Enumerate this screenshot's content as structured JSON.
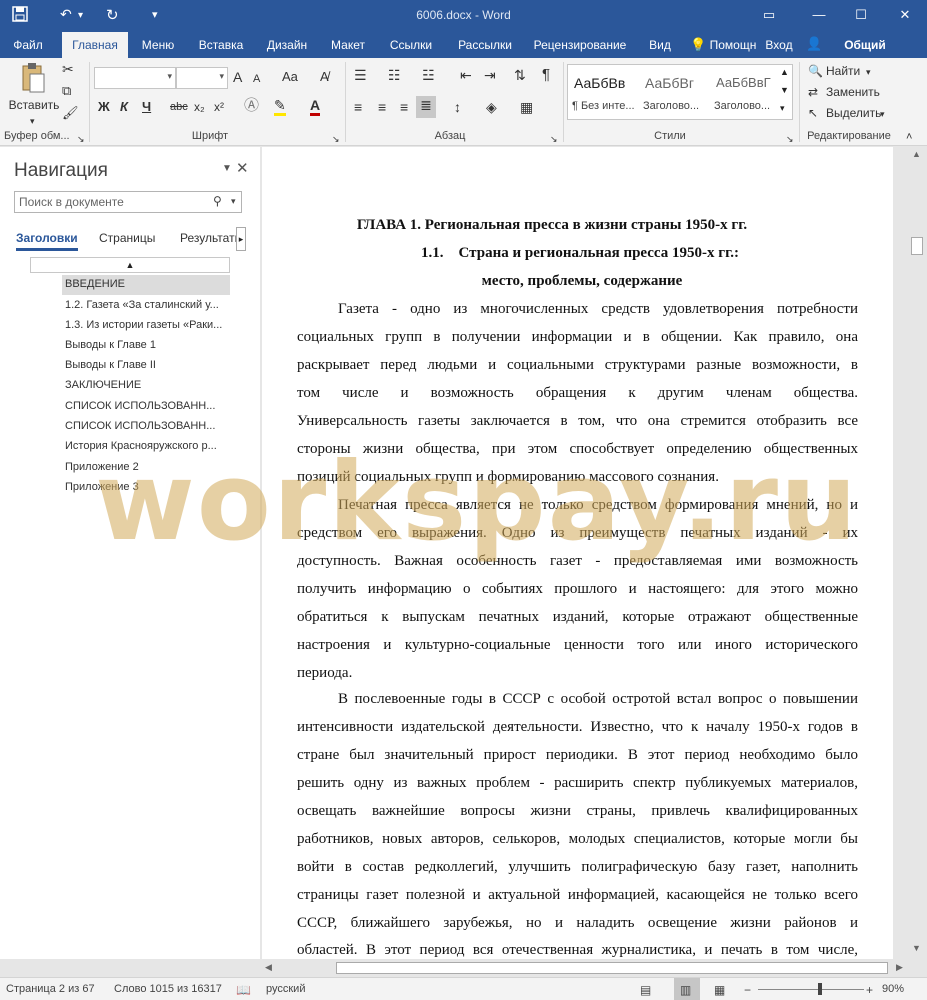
{
  "titlebar": {
    "doc_title": "6006.docx - Word",
    "window_controls": [
      "ribbon-display-icon",
      "minimize-icon",
      "maximize-icon",
      "close-icon"
    ]
  },
  "tabs": {
    "file": "Файл",
    "home": "Главная",
    "menu": "Меню",
    "insert": "Вставка",
    "design": "Дизайн",
    "layout": "Макет",
    "references": "Ссылки",
    "mailings": "Рассылки",
    "review": "Рецензирование",
    "view": "Вид",
    "help": "Помощн",
    "signin": "Вход",
    "share": "Общий доступ"
  },
  "ribbon": {
    "paste": "Вставить",
    "clipboard_label": "Буфер обм...",
    "font_label": "Шрифт",
    "paragraph_label": "Абзац",
    "styles_label": "Стили",
    "editing_label": "Редактирование",
    "bold": "Ж",
    "italic": "К",
    "underline": "Ч",
    "strike": "abc",
    "subscript": "x₂",
    "superscript": "x²",
    "grow_font": "A",
    "shrink_font": "A",
    "change_case": "Aa",
    "styles": [
      {
        "sample": "АаБбВв",
        "name": "¶ Без инте..."
      },
      {
        "sample": "АаБбВг",
        "name": "Заголово..."
      },
      {
        "sample": "АаБбВвГ",
        "name": "Заголово..."
      }
    ],
    "find": "Найти",
    "replace": "Заменить",
    "select": "Выделить"
  },
  "nav": {
    "title": "Навигация",
    "search_placeholder": "Поиск в документе",
    "tab_headings": "Заголовки",
    "tab_pages": "Страницы",
    "tab_results": "Результаты",
    "items": [
      "ВВЕДЕНИЕ",
      "1.2. Газета «За сталинский у...",
      "1.3. Из истории газеты «Раки...",
      "Выводы к Главе 1",
      "Выводы к Главе II",
      "ЗАКЛЮЧЕНИЕ",
      "СПИСОК ИСПОЛЬЗОВАНН...",
      "СПИСОК ИСПОЛЬЗОВАНН...",
      "История Краснояружского р...",
      "Приложение 2",
      "Приложение 3"
    ]
  },
  "doc": {
    "heading1": "ГЛАВА 1. Региональная пресса в жизни страны 1950-х гг.",
    "heading2": "1.1.    Страна и региональная пресса 1950-х гг.:",
    "heading3": "место, проблемы, содержание",
    "lines": [
      "Газета - одно из многочисленных средств удовлетворения потребности",
      "социальных групп в получении информации и в общении. Как правило, она",
      "раскрывает перед людьми и социальными структурами разные возможности, в",
      "том числе и возможность обращения к другим членам общества.",
      "Универсальность газеты заключается в том, что она стремится отобразить все",
      "стороны жизни общества, при этом способствует определению общественных",
      "позиций социальных групп и формированию массового сознания.",
      "Печатная пресса является не только средством формирования мнений, но и",
      "средством его выражения. Одно из преимуществ печатных изданий - их",
      "доступность. Важная особенность газет - предоставляемая ими возможность",
      "получить информацию о событиях прошлого и настоящего: для этого можно",
      "обратиться к выпускам печатных изданий, которые отражают общественные",
      "настроения и культурно-социальные ценности того или иного исторического",
      "периода.",
      "В послевоенные годы в СССР с особой остротой встал вопрос о повышении",
      "интенсивности издательской деятельности. Известно, что к началу 1950-х годов в",
      "стране был значительный прирост периодики. В этот период необходимо было",
      "решить одну из важных проблем - расширить спектр публикуемых материалов,",
      "освещать важнейшие вопросы жизни страны, привлечь квалифицированных",
      "работников, новых авторов, селькоров, молодых специалистов, которые могли бы",
      "войти в состав редколлегий, улучшить полиграфическую базу газет, наполнить",
      "страницы газет полезной и актуальной информацией, касающейся не только всего",
      "СССР, ближайшего зарубежья, но и наладить освещение жизни районов и",
      "областей. В этот период вся отечественная журналистика, и печать в том числе,"
    ]
  },
  "watermark": "workspay.ru",
  "status": {
    "page": "Страница 2 из 67",
    "words": "Слово 1015 из 16317",
    "language": "русский",
    "zoom": "90%"
  }
}
